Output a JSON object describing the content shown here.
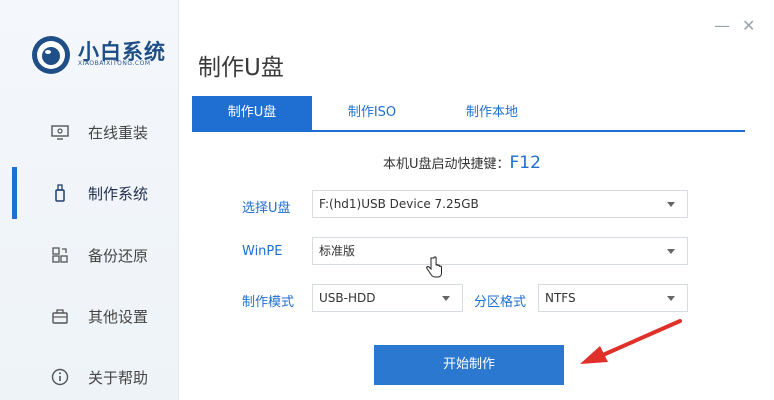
{
  "app": {
    "logo_title": "小白系统",
    "logo_subtitle": "XIAOBAIXITONG.COM",
    "window_controls": {
      "minimize": "—",
      "close": "✕"
    }
  },
  "sidebar": {
    "items": [
      {
        "label": "在线重装",
        "icon": "monitor-icon",
        "active": false
      },
      {
        "label": "制作系统",
        "icon": "usb-drive-icon",
        "active": true
      },
      {
        "label": "备份还原",
        "icon": "backup-icon",
        "active": false
      },
      {
        "label": "其他设置",
        "icon": "toolbox-icon",
        "active": false
      },
      {
        "label": "关于帮助",
        "icon": "info-icon",
        "active": false
      }
    ]
  },
  "main": {
    "title": "制作U盘",
    "tabs": [
      {
        "label": "制作U盘",
        "active": true
      },
      {
        "label": "制作ISO",
        "active": false
      },
      {
        "label": "制作本地",
        "active": false
      }
    ],
    "hotkey": {
      "label": "本机U盘启动快捷键：",
      "key": "F12"
    },
    "form": {
      "usb_label": "选择U盘",
      "usb_value": "F:(hd1)USB Device 7.25GB",
      "winpe_label": "WinPE",
      "winpe_value": "标准版",
      "mode_label": "制作模式",
      "mode_value": "USB-HDD",
      "format_label": "分区格式",
      "format_value": "NTFS"
    },
    "start_button": "开始制作"
  },
  "colors": {
    "accent": "#1e6fd1",
    "annotation_arrow": "#e0302a"
  }
}
